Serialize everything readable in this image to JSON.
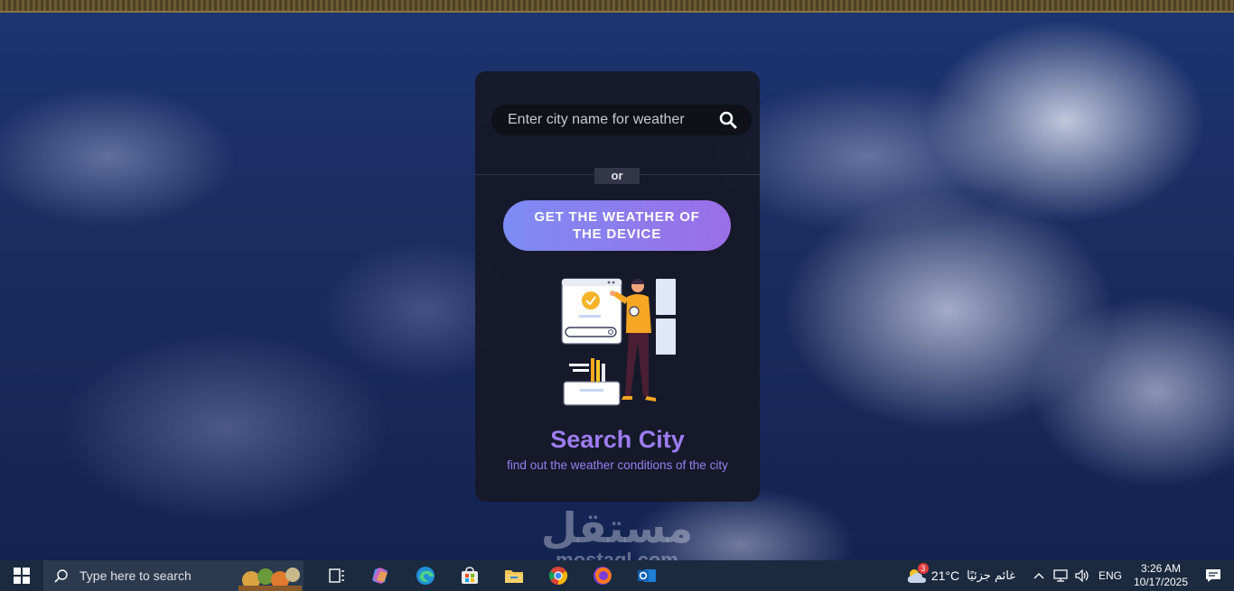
{
  "search": {
    "placeholder": "Enter city name for weather",
    "icon": "search-icon"
  },
  "divider": {
    "label": "or"
  },
  "device_button": {
    "label": "GET THE WEATHER OF THE DEVICE"
  },
  "hero": {
    "title": "Search City",
    "subtitle": "find out the weather conditions of the city"
  },
  "watermark": {
    "arabic": "مستقل",
    "latin": "mostaql.com"
  },
  "taskbar": {
    "search_placeholder": "Type here to search",
    "apps": [
      "task-view-icon",
      "copilot-icon",
      "edge-icon",
      "store-icon",
      "file-explorer-icon",
      "chrome-icon",
      "firefox-icon",
      "outlook-icon"
    ],
    "weather": {
      "temp": "21°C",
      "condition": "غائم جزئيًا",
      "badge": "3"
    },
    "language": "ENG",
    "time": "3:26 AM",
    "date": "10/17/2025"
  },
  "colors": {
    "card_bg": "#161826",
    "button_start": "#7d8cf5",
    "button_end": "#9b6ee6",
    "title": "#9d7cf0",
    "taskbar": "#1b2a3f"
  }
}
